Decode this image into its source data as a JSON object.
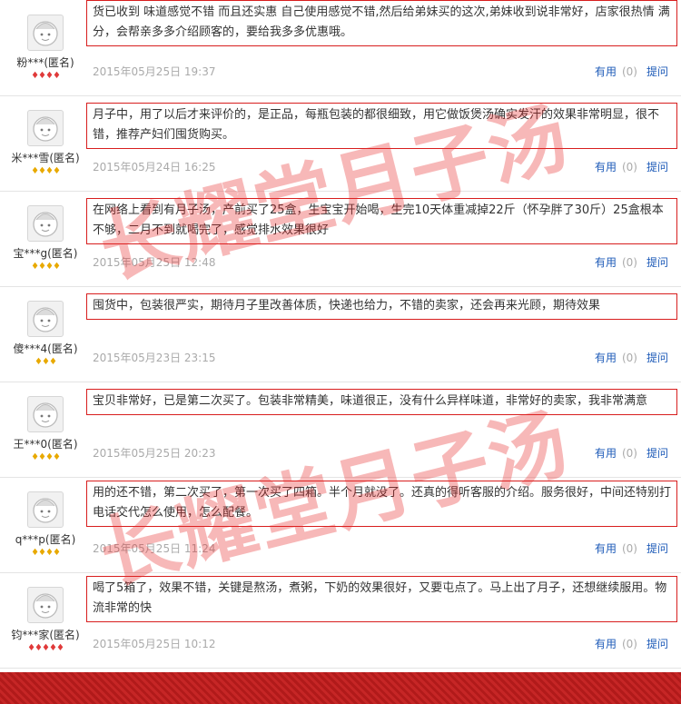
{
  "watermark": "长耀堂月子汤",
  "helpful_label": "有用",
  "ask_label": "提问",
  "reviews": [
    {
      "user": "粉***(匿名)",
      "rank": "♦♦♦♦",
      "rank_color": "red",
      "text": "货已收到 味道感觉不错 而且还实惠 自己使用感觉不错,然后给弟妹买的这次,弟妹收到说非常好，店家很热情 满分，会帮亲多多介绍顾客的，要给我多多优惠哦。",
      "date": "2015年05月25日 19:37",
      "helpful": "(0)"
    },
    {
      "user": "米***雪(匿名)",
      "rank": "♦♦♦♦",
      "rank_color": "gold",
      "text": "月子中，用了以后才来评价的，是正品，每瓶包装的都很细致，用它做饭煲汤确实发汗的效果非常明显，很不错，推荐产妇们囤货购买。",
      "date": "2015年05月24日 16:25",
      "helpful": "(0)"
    },
    {
      "user": "宝***g(匿名)",
      "rank": "♦♦♦♦",
      "rank_color": "gold",
      "text": "在网络上看到有月子汤，产前买了25盒，生宝宝开始喝，生完10天体重减掉22斤（怀孕胖了30斤）25盒根本不够，二月不到就喝完了，感觉排水效果很好",
      "date": "2015年05月25日 12:48",
      "helpful": "(0)"
    },
    {
      "user": "傻***4(匿名)",
      "rank": "♦♦♦",
      "rank_color": "gold",
      "text": "囤货中，包装很严实，期待月子里改善体质，快递也给力，不错的卖家，还会再来光顾，期待效果",
      "date": "2015年05月23日 23:15",
      "helpful": "(0)"
    },
    {
      "user": "王***0(匿名)",
      "rank": "♦♦♦♦",
      "rank_color": "gold",
      "text": "宝贝非常好，已是第二次买了。包装非常精美，味道很正，没有什么异样味道，非常好的卖家，我非常满意",
      "date": "2015年05月25日 20:23",
      "helpful": "(0)"
    },
    {
      "user": "q***p(匿名)",
      "rank": "♦♦♦♦",
      "rank_color": "gold",
      "text": "用的还不错，第二次买了，第一次买了四箱。半个月就没了。还真的得听客服的介绍。服务很好，中间还特别打电话交代怎么使用，怎么配餐。",
      "date": "2015年05月25日 11:24",
      "helpful": "(0)"
    },
    {
      "user": "钧***家(匿名)",
      "rank": "♦♦♦♦♦",
      "rank_color": "red",
      "text": "喝了5箱了，效果不错，关键是熬汤，煮粥，下奶的效果很好，又要屯点了。马上出了月子，还想继续服用。物流非常的快",
      "date": "2015年05月25日 10:12",
      "helpful": "(0)"
    }
  ]
}
